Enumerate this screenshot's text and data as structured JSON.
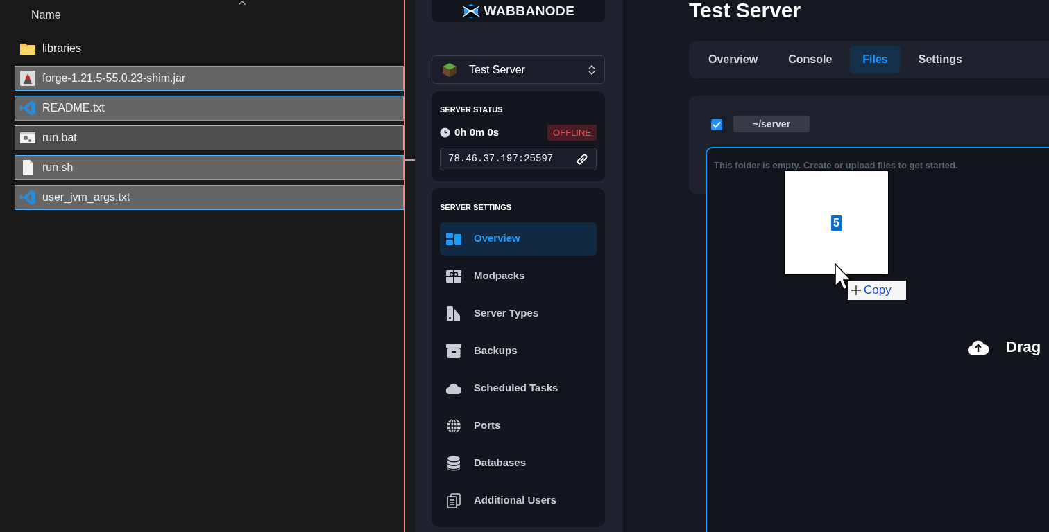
{
  "explorer": {
    "column_header": "Name",
    "files": [
      {
        "name": "libraries",
        "kind": "folder",
        "selected": false,
        "focused": false
      },
      {
        "name": "forge-1.21.5-55.0.23-shim.jar",
        "kind": "jar",
        "selected": true,
        "focused": false
      },
      {
        "name": "README.txt",
        "kind": "code",
        "selected": true,
        "focused": false
      },
      {
        "name": "run.bat",
        "kind": "batch",
        "selected": true,
        "focused": true
      },
      {
        "name": "run.sh",
        "kind": "file",
        "selected": true,
        "focused": false
      },
      {
        "name": "user_jvm_args.txt",
        "kind": "code",
        "selected": true,
        "focused": false
      }
    ]
  },
  "sidebar": {
    "logo": "WABBANODE",
    "server_picker": {
      "value": "Test Server"
    },
    "status": {
      "heading": "SERVER STATUS",
      "uptime": "0h 0m 0s",
      "badge": "OFFLINE",
      "address": "78.46.37.197:25597"
    },
    "settings": {
      "heading": "SERVER SETTINGS",
      "items": [
        {
          "label": "Overview",
          "kind": "overview",
          "selected": true
        },
        {
          "label": "Modpacks",
          "kind": "modpacks",
          "selected": false
        },
        {
          "label": "Server Types",
          "kind": "types",
          "selected": false
        },
        {
          "label": "Backups",
          "kind": "backups",
          "selected": false
        },
        {
          "label": "Scheduled Tasks",
          "kind": "tasks",
          "selected": false
        },
        {
          "label": "Ports",
          "kind": "ports",
          "selected": false
        },
        {
          "label": "Databases",
          "kind": "databases",
          "selected": false
        },
        {
          "label": "Additional Users",
          "kind": "users",
          "selected": false
        }
      ]
    }
  },
  "main": {
    "title": "Test Server",
    "tabs": [
      {
        "label": "Overview",
        "selected": false
      },
      {
        "label": "Console",
        "selected": false
      },
      {
        "label": "Files",
        "selected": true
      },
      {
        "label": "Settings",
        "selected": false
      }
    ],
    "select_all": {
      "checked": true
    },
    "path": "~/server",
    "empty_message": "This folder is empty. Create or upload files to get started.",
    "drop_label": "Drag"
  },
  "drag_preview": {
    "count": "5",
    "effect": "Copy"
  }
}
